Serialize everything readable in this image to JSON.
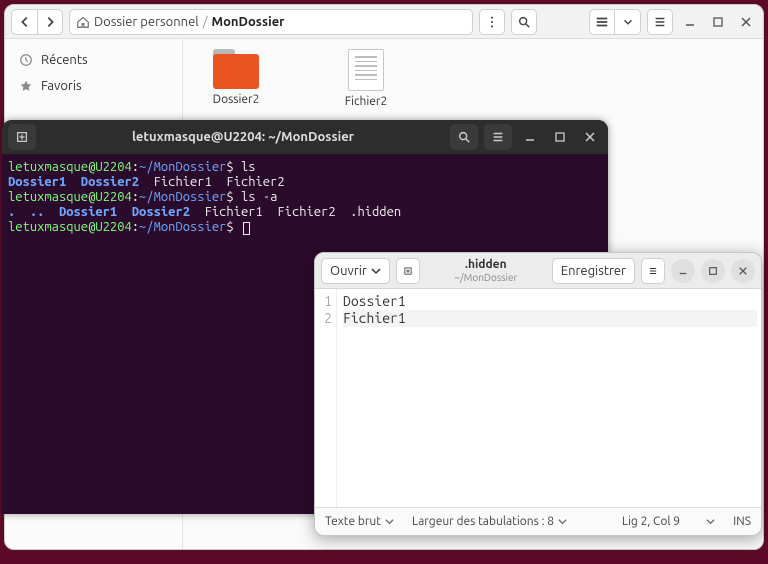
{
  "files": {
    "breadcrumb": {
      "home": "Dossier personnel",
      "current": "MonDossier"
    },
    "sidebar": {
      "recents": "Récents",
      "favorites": "Favoris"
    },
    "items": {
      "folder": "Dossier2",
      "file": "Fichier2"
    }
  },
  "terminal": {
    "title": "letuxmasque@U2204: ~/MonDossier",
    "prompt_user": "letuxmasque@U2204",
    "prompt_path": "~/MonDossier",
    "cmd1": "ls",
    "out1_dirs": "Dossier1  Dossier2",
    "out1_files": "Fichier1  Fichier2",
    "cmd2": "ls -a",
    "out2_dots": ".  ..",
    "out2_dirs": "Dossier1  Dossier2",
    "out2_files": "Fichier1  Fichier2  .hidden"
  },
  "gedit": {
    "open": "Ouvrir",
    "save": "Enregistrer",
    "filename": ".hidden",
    "subtitle": "~/MonDossier",
    "lines": {
      "n1": "1",
      "n2": "2",
      "l1": "Dossier1",
      "l2": "Fichier1"
    },
    "status": {
      "syntax": "Texte brut",
      "tabs": "Largeur des tabulations : 8",
      "pos": "Lig 2, Col 9",
      "ins": "INS"
    }
  }
}
